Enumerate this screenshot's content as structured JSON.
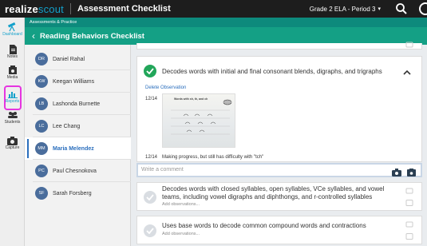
{
  "brand": {
    "realize": "realize",
    "scout": "scout"
  },
  "header": {
    "title": "Assessment Checklist",
    "class_selector": "Grade 2 ELA - Period 3"
  },
  "rail": [
    {
      "label": "Dashboard",
      "icon": "telescope-icon",
      "active": true
    },
    {
      "label": "Notes",
      "icon": "document-icon"
    },
    {
      "label": "Media",
      "icon": "media-icon"
    },
    {
      "label": "Reports",
      "icon": "reports-icon"
    },
    {
      "label": "Students",
      "icon": "students-icon"
    },
    {
      "label": "Capture",
      "icon": "camera-icon"
    }
  ],
  "breadcrumb": "Assessments & Practice",
  "page_title": "Reading Behaviors Checklist",
  "students": [
    {
      "initials": "DR",
      "name": "Daniel Rahal"
    },
    {
      "initials": "KW",
      "name": "Keegan Williams"
    },
    {
      "initials": "LB",
      "name": "Lashonda Burnette"
    },
    {
      "initials": "LC",
      "name": "Lee Chang"
    },
    {
      "initials": "MM",
      "name": "Maria Melendez",
      "selected": true
    },
    {
      "initials": "PC",
      "name": "Paul Chesnokova"
    },
    {
      "initials": "SF",
      "name": "Sarah Forsberg"
    }
  ],
  "expanded": {
    "skill": "Decodes words with initial and final consonant blends, digraphs, and trigraphs",
    "delete_link": "Delete Observation",
    "obs1_date": "12/14",
    "worksheet_title": "Words with sh, th, and ch",
    "obs2_date": "12/14",
    "obs2_text": "Making progress, but still has difficulty with \"tch\"",
    "comment_placeholder": "Write a comment"
  },
  "other_skills": [
    {
      "text": "Decodes words with closed syllables, open syllables, VCe syllables, and vowel teams, including vowel digraphs and diphthongs, and r-controlled syllables",
      "add": "Add observations..."
    },
    {
      "text": "Uses base words to decode common compound words and contractions",
      "add": "Add observations..."
    }
  ],
  "colors": {
    "topbar": "#1d1d1d",
    "brand_accent": "#13a0ca",
    "header_green": "#14a085",
    "crumb_green": "#0d8a7c",
    "check_green": "#22a65a",
    "highlight": "#e535e0",
    "link_blue": "#2a6ebd"
  }
}
